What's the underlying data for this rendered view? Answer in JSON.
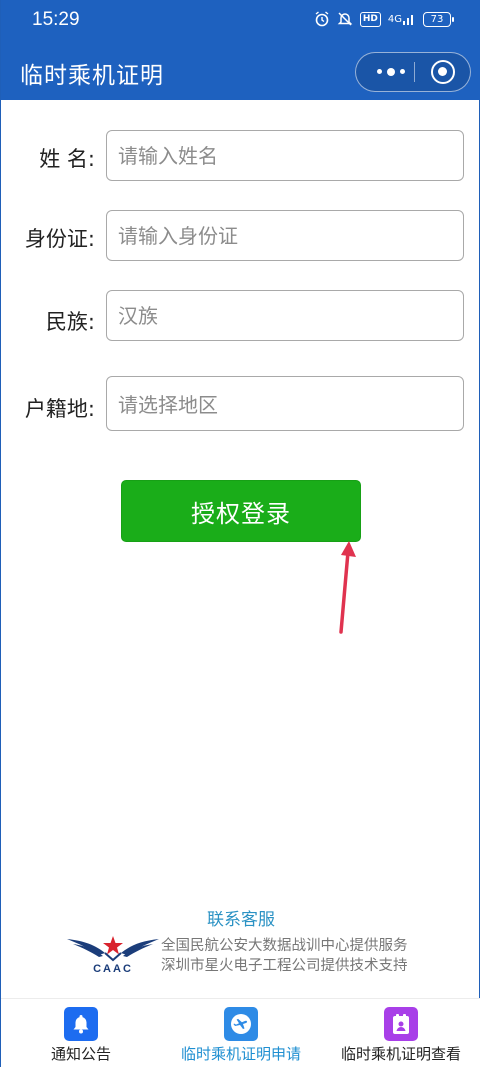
{
  "status_bar": {
    "time": "15:29",
    "hd": "HD",
    "network": "4G",
    "battery": "73"
  },
  "nav": {
    "title": "临时乘机证明"
  },
  "form": {
    "name_label": "姓 名:",
    "name_placeholder": "请输入姓名",
    "id_label": "身份证:",
    "id_placeholder": "请输入身份证",
    "ethnicity_label": "民族:",
    "ethnicity_value": "汉族",
    "domicile_label": "户籍地:",
    "domicile_placeholder": "请选择地区"
  },
  "login_button": "授权登录",
  "footer": {
    "contact": "联系客服",
    "logo_text": "CAAC",
    "provider_line1": "全国民航公安大数据战训中心提供服务",
    "provider_line2": "深圳市星火电子工程公司提供技术支持"
  },
  "tabbar": {
    "tabs": [
      {
        "label": "通知公告",
        "icon": "bell-icon"
      },
      {
        "label": "临时乘机证明申请",
        "icon": "airplane-icon",
        "active": true
      },
      {
        "label": "临时乘机证明查看",
        "icon": "certificate-icon"
      }
    ]
  },
  "colors": {
    "header": "#1e61bf",
    "primary_button": "#1aad19",
    "link": "#2b92c4",
    "annotation_arrow": "#e0334f"
  }
}
